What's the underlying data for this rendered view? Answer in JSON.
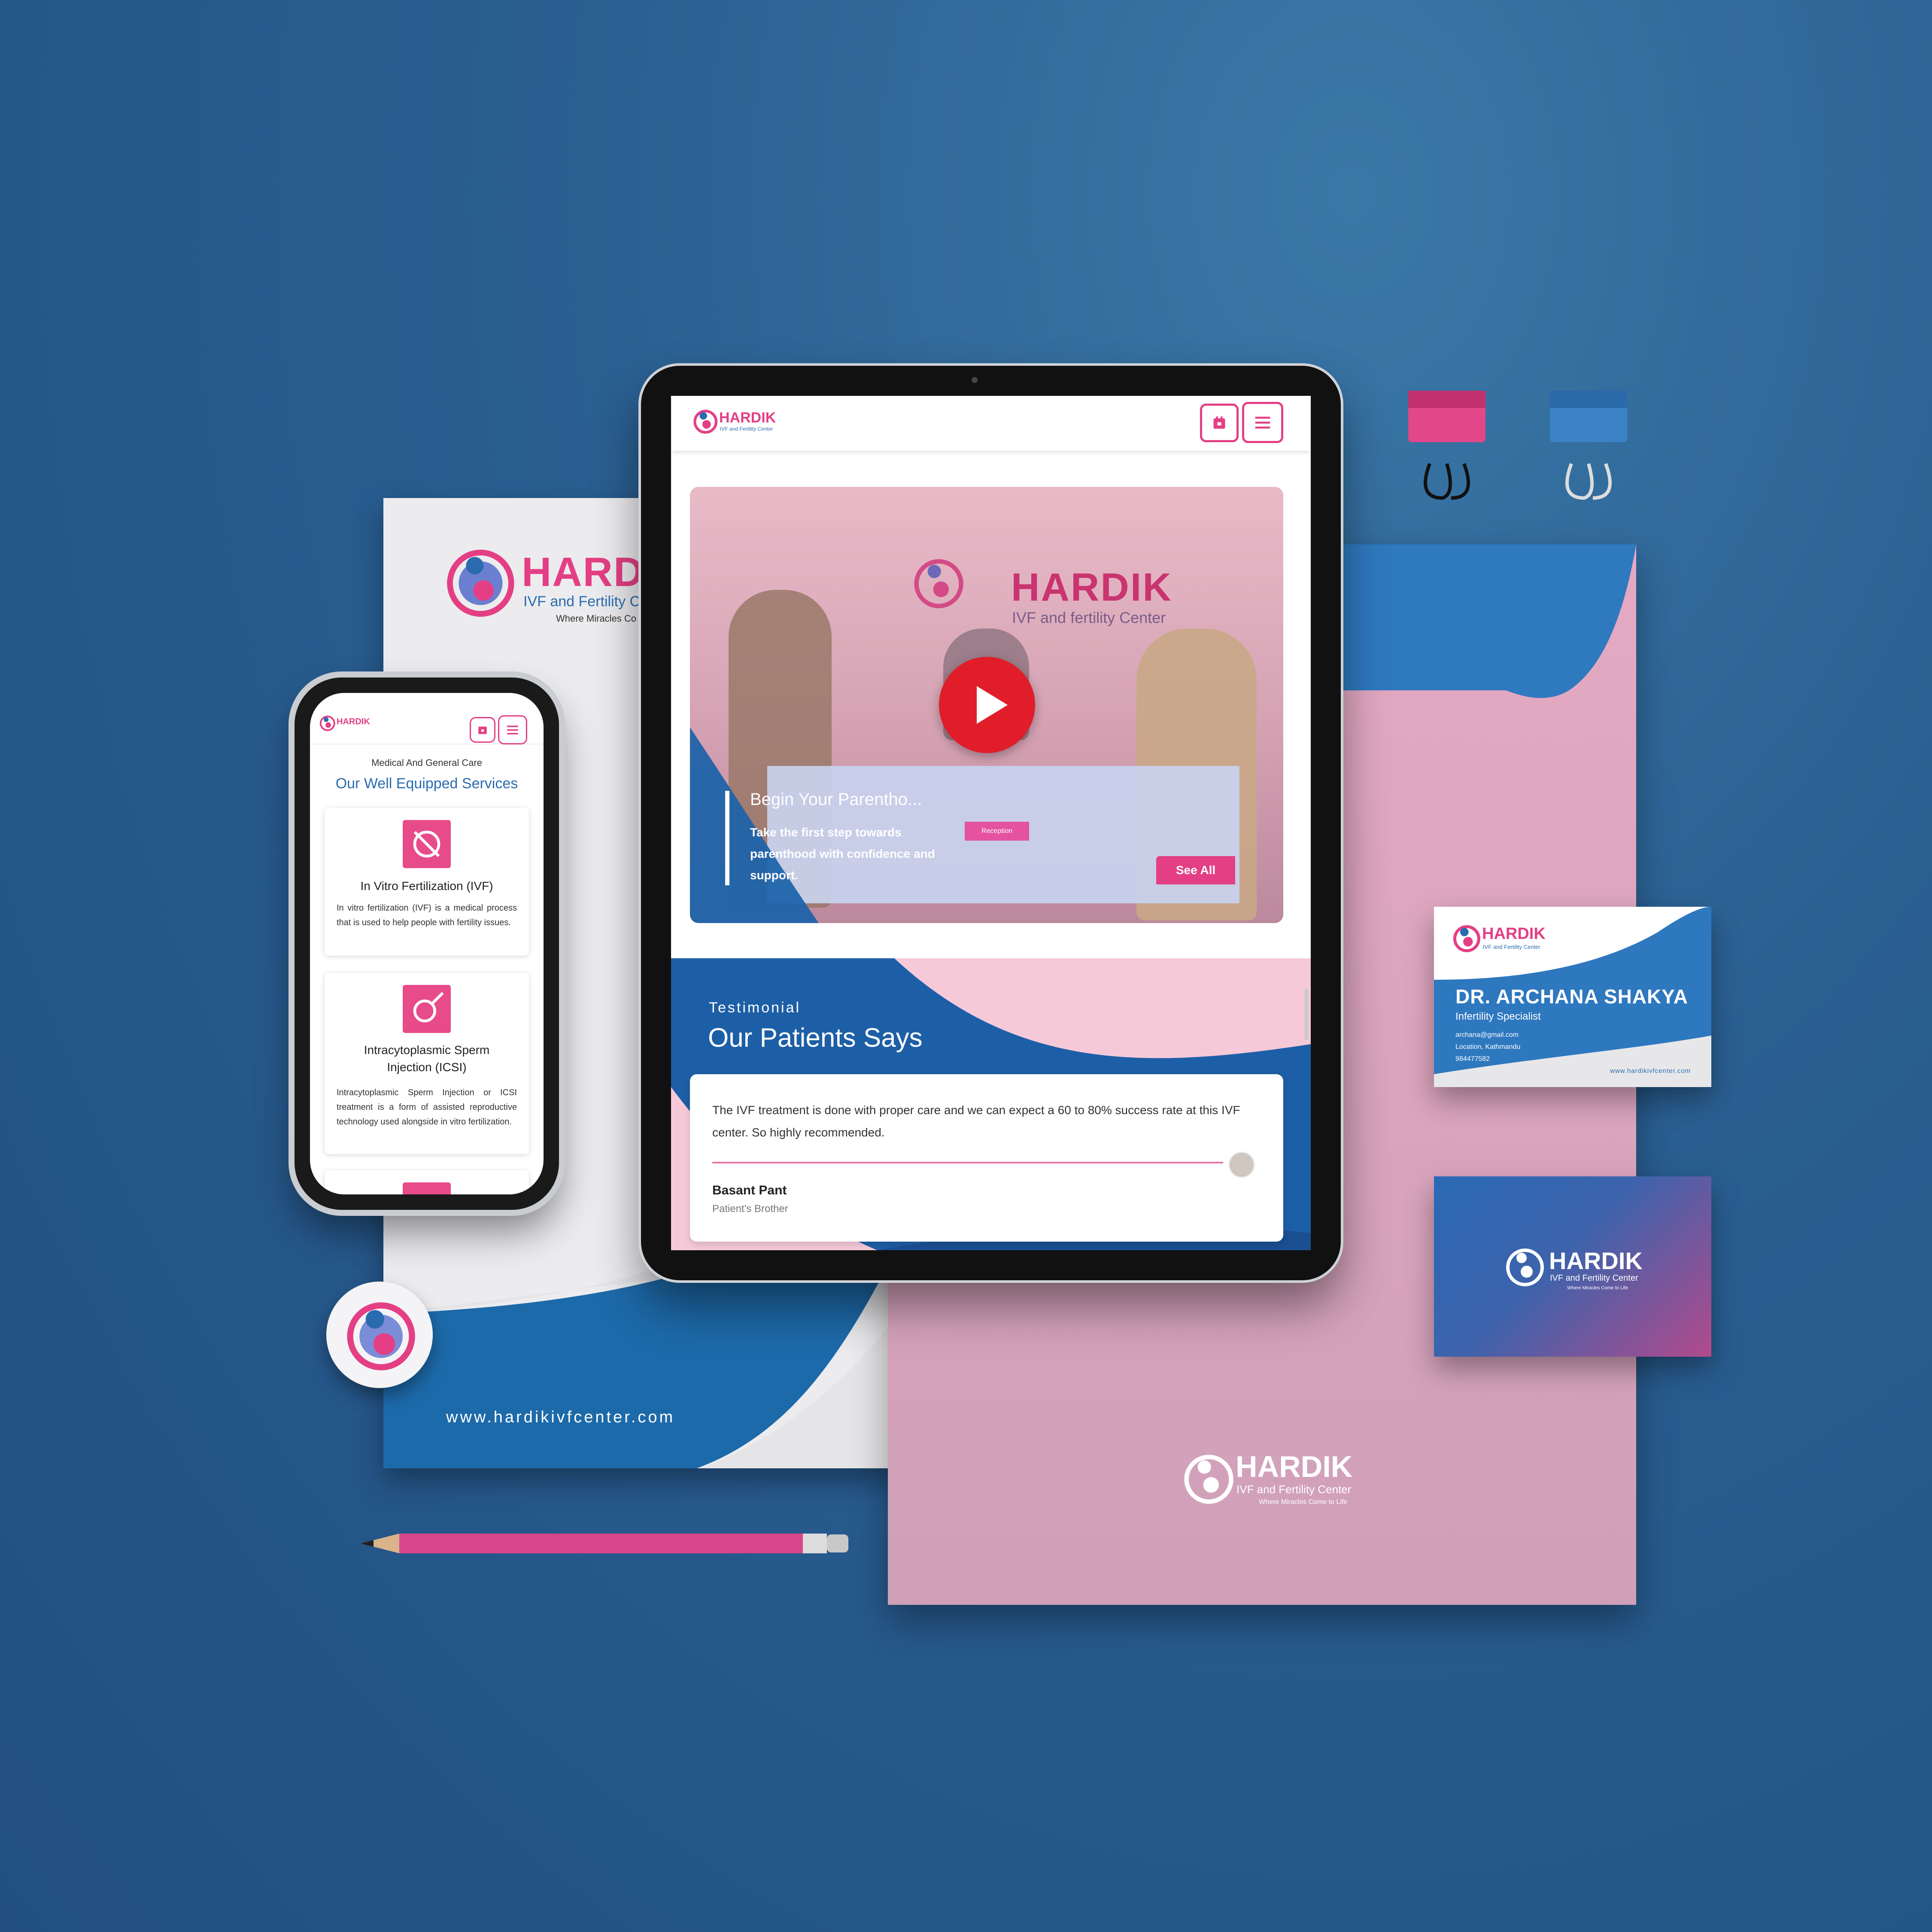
{
  "brand": {
    "name": "HARDIK",
    "subtitle": "IVF and Fertility Center",
    "subtitle_lower": "IVF and fertility Center",
    "tagline": "Where Miracles Come to Life",
    "colors": {
      "pink": "#e43f84",
      "blue": "#2a6bb0",
      "background": "#2a5f92"
    }
  },
  "letterhead": {
    "website": "www.hardikivfcenter.com",
    "subtitle_partial": "IVF and Fertility C",
    "tagline_partial": "Where Miracles Co"
  },
  "tablet": {
    "header": {
      "logo_name": "HARDIK",
      "logo_sub": "IVF and Fertility Center",
      "calendar_icon": "calendar-icon",
      "menu_icon": "menu-icon"
    },
    "hero": {
      "heading": "Begin Your Parentho...",
      "text": "Take the first step towards parenthood with confidence and support.",
      "see_all": "See All",
      "reception_label": "Reception"
    },
    "testimonial": {
      "eyebrow": "Testimonial",
      "heading": "Our Patients Says",
      "quote": "The IVF treatment is done with proper care and we can expect a 60 to 80% success rate at this IVF center. So highly recommended.",
      "author": "Basant Pant",
      "relation": "Patient's Brother"
    }
  },
  "phone": {
    "eyebrow": "Medical And General Care",
    "heading": "Our Well Equipped Services",
    "services": [
      {
        "title": "In Vitro Fertilization (IVF)",
        "desc": "In vitro fertilization (IVF) is a medical process that is used to help people with fertility issues."
      },
      {
        "title": "Intracytoplasmic Sperm Injection (ICSI)",
        "desc": "Intracytoplasmic Sperm Injection or ICSI treatment is a form of assisted reproductive technology used alongside in vitro fertilization."
      }
    ]
  },
  "business_card": {
    "name": "DR. ARCHANA SHAKYA",
    "role": "Infertility Specialist",
    "email": "archana@gmail.com",
    "location": "Location, Kathmandu",
    "phone": "984477582",
    "website": "www.hardikivfcenter.com"
  },
  "folder": {
    "logo_name": "HARDIK",
    "logo_sub": "IVF and Fertility Center",
    "tagline": "Where Miracles Come to Life"
  }
}
